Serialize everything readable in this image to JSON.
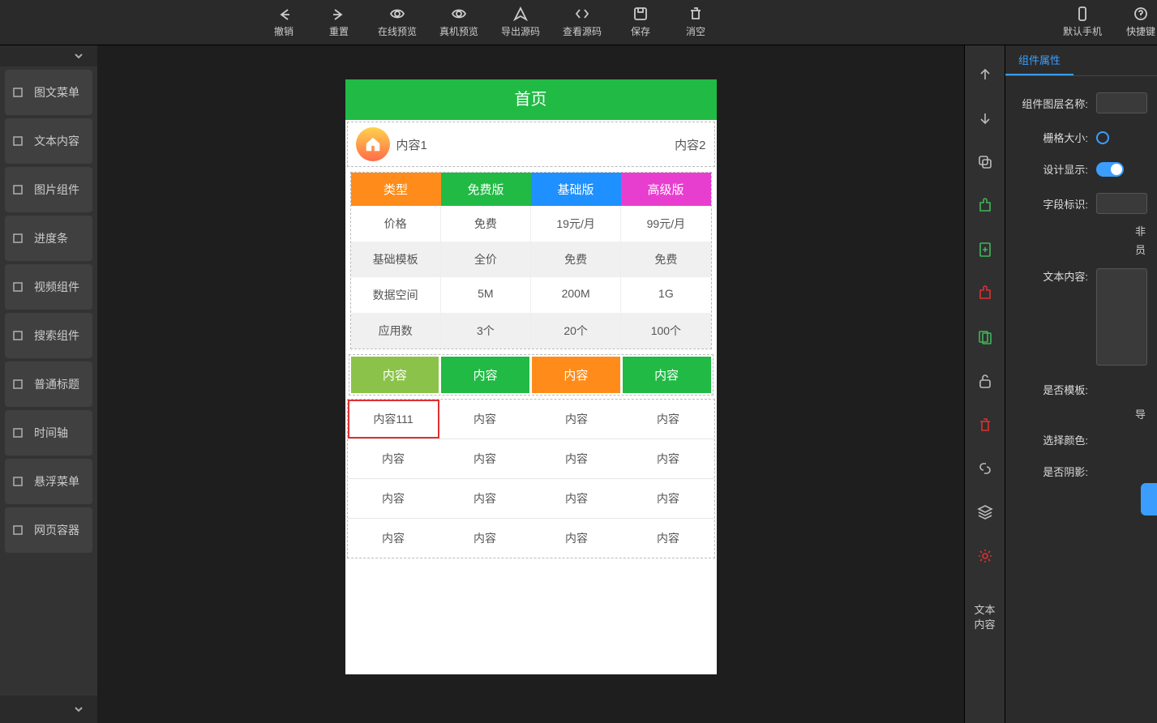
{
  "toolbar": {
    "undo": "撤销",
    "redo": "重置",
    "preview_online": "在线预览",
    "preview_device": "真机预览",
    "export_source": "导出源码",
    "view_source": "查看源码",
    "save": "保存",
    "clear": "消空",
    "default_phone": "默认手机",
    "shortcuts": "快捷键"
  },
  "left_components": [
    "图文菜单",
    "文本内容",
    "图片组件",
    "进度条",
    "视频组件",
    "搜索组件",
    "普通标题",
    "时间轴",
    "悬浮菜单",
    "网页容器"
  ],
  "phone": {
    "title": "首页",
    "row1_left": "内容1",
    "row1_right": "内容2",
    "table1": {
      "headers": [
        "类型",
        "免费版",
        "基础版",
        "高级版"
      ],
      "rows": [
        [
          "价格",
          "免费",
          "19元/月",
          "99元/月"
        ],
        [
          "基础模板",
          "全价",
          "免费",
          "免费"
        ],
        [
          "数据空间",
          "5M",
          "200M",
          "1G"
        ],
        [
          "应用数",
          "3个",
          "20个",
          "100个"
        ]
      ]
    },
    "table2": {
      "headers": [
        "内容",
        "内容",
        "内容",
        "内容"
      ],
      "rows": [
        [
          "内容111",
          "内容",
          "内容",
          "内容"
        ],
        [
          "内容",
          "内容",
          "内容",
          "内容"
        ],
        [
          "内容",
          "内容",
          "内容",
          "内容"
        ],
        [
          "内容",
          "内容",
          "内容",
          "内容"
        ]
      ],
      "selected": [
        0,
        0
      ]
    }
  },
  "rail_text": "文本\n内容",
  "props": {
    "tab_active": "组件属性",
    "labels": {
      "layer_name": "组件图层名称:",
      "grid_size": "栅格大小:",
      "design_display": "设计显示:",
      "field_flag": "字段标识:",
      "extra_line1": "非",
      "extra_line2": "员",
      "text_content": "文本内容:",
      "is_template": "是否模板:",
      "export": "导",
      "choose_color": "选择颜色:",
      "has_shadow": "是否阴影:"
    }
  }
}
